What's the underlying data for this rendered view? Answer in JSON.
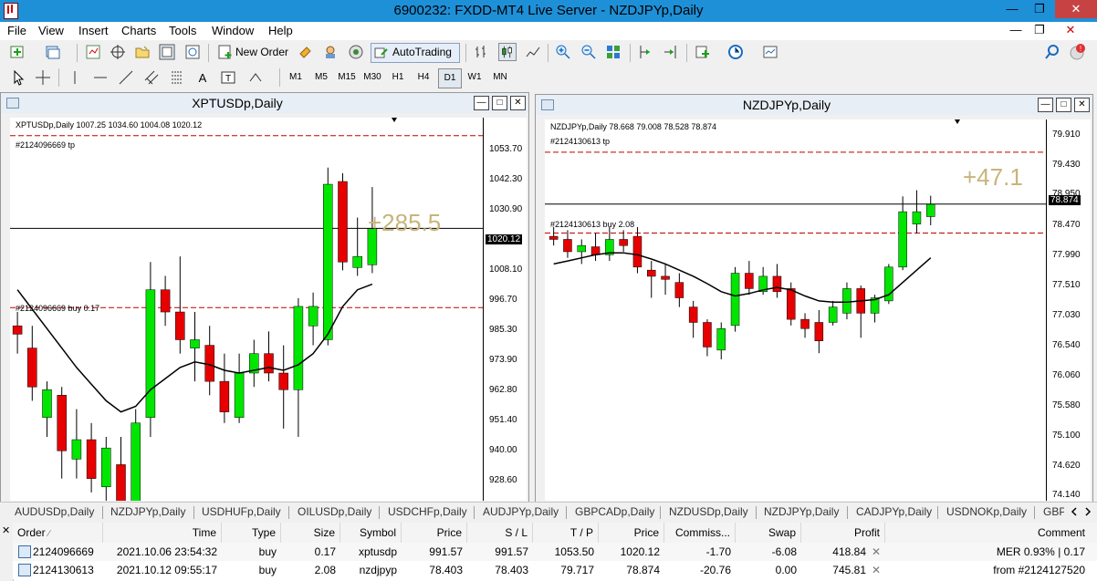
{
  "window": {
    "title": "6900232: FXDD-MT4 Live Server - NZDJPYp,Daily"
  },
  "menu": [
    "File",
    "View",
    "Insert",
    "Charts",
    "Tools",
    "Window",
    "Help"
  ],
  "toolbar": {
    "new_order": "New Order",
    "autotrading": "AutoTrading"
  },
  "timeframes": [
    "M1",
    "M5",
    "M15",
    "M30",
    "H1",
    "H4",
    "D1",
    "W1",
    "MN"
  ],
  "active_timeframe": "D1",
  "charts": [
    {
      "title": "XPTUSDp,Daily",
      "info": "XPTUSDp,Daily  1007.25 1034.60 1004.08 1020.12",
      "price_labels": [
        "1053.70",
        "1042.30",
        "1030.90",
        "1020.12",
        "1008.10",
        "996.70",
        "985.30",
        "973.90",
        "962.80",
        "951.40",
        "940.00",
        "928.60"
      ],
      "current_price": "1020.12",
      "tp_label": "#2124096669 tp",
      "order_label": "#2124096669 buy 0.17",
      "profit": "+285.5",
      "chart_data": {
        "type": "candlestick",
        "symbol": "XPTUSDp",
        "ylim": [
          922.0,
          1060.0
        ],
        "current": 1020.12,
        "tp_level": 1053.5,
        "order_level": 991.57,
        "candles": [
          {
            "o": 985,
            "h": 990,
            "l": 975,
            "c": 982
          },
          {
            "o": 977,
            "h": 985,
            "l": 958,
            "c": 963
          },
          {
            "o": 952,
            "h": 965,
            "l": 945,
            "c": 962
          },
          {
            "o": 960,
            "h": 963,
            "l": 930,
            "c": 940
          },
          {
            "o": 937,
            "h": 955,
            "l": 930,
            "c": 944
          },
          {
            "o": 944,
            "h": 950,
            "l": 925,
            "c": 930
          },
          {
            "o": 927,
            "h": 945,
            "l": 920,
            "c": 941
          },
          {
            "o": 935,
            "h": 945,
            "l": 900,
            "c": 904
          },
          {
            "o": 900,
            "h": 955,
            "l": 895,
            "c": 950
          },
          {
            "o": 952,
            "h": 1008,
            "l": 945,
            "c": 998
          },
          {
            "o": 998,
            "h": 1003,
            "l": 985,
            "c": 990
          },
          {
            "o": 990,
            "h": 1010,
            "l": 975,
            "c": 980
          },
          {
            "o": 977,
            "h": 990,
            "l": 965,
            "c": 980
          },
          {
            "o": 978,
            "h": 985,
            "l": 960,
            "c": 965
          },
          {
            "o": 965,
            "h": 975,
            "l": 950,
            "c": 954
          },
          {
            "o": 952,
            "h": 975,
            "l": 950,
            "c": 968
          },
          {
            "o": 968,
            "h": 980,
            "l": 963,
            "c": 975
          },
          {
            "o": 975,
            "h": 983,
            "l": 965,
            "c": 968
          },
          {
            "o": 968,
            "h": 978,
            "l": 948,
            "c": 962
          },
          {
            "o": 962,
            "h": 995,
            "l": 945,
            "c": 992
          },
          {
            "o": 985,
            "h": 997,
            "l": 978,
            "c": 992
          },
          {
            "o": 980,
            "h": 1042,
            "l": 978,
            "c": 1036
          },
          {
            "o": 1037,
            "h": 1040,
            "l": 1005,
            "c": 1008
          },
          {
            "o": 1006,
            "h": 1024,
            "l": 1003,
            "c": 1010
          },
          {
            "o": 1007,
            "h": 1035,
            "l": 1004,
            "c": 1020
          }
        ],
        "ma": [
          998,
          991,
          984,
          977,
          970,
          964,
          958,
          954,
          956,
          962,
          966,
          970,
          972,
          971,
          969,
          968,
          969,
          970,
          969,
          971,
          975,
          982,
          992,
          998,
          1000
        ]
      }
    },
    {
      "title": "NZDJPYp,Daily",
      "info": "NZDJPYp,Daily  78.668 79.008 78.528 78.874",
      "price_labels": [
        "79.910",
        "79.430",
        "78.950",
        "78.874",
        "78.470",
        "77.990",
        "77.510",
        "77.030",
        "76.540",
        "76.060",
        "75.580",
        "75.100",
        "74.620",
        "74.140"
      ],
      "current_price": "78.874",
      "tp_label": "#2124130613 tp",
      "order_label": "#2124130613 buy 2.08",
      "profit": "+47.1",
      "chart_data": {
        "type": "candlestick",
        "symbol": "NZDJPYp",
        "ylim": [
          74.05,
          80.25
        ],
        "current": 78.874,
        "tp_level": 79.717,
        "order_level": 78.403,
        "candles": [
          {
            "o": 78.35,
            "h": 78.5,
            "l": 78.2,
            "c": 78.3
          },
          {
            "o": 78.3,
            "h": 78.45,
            "l": 78.0,
            "c": 78.1
          },
          {
            "o": 78.1,
            "h": 78.3,
            "l": 77.9,
            "c": 78.2
          },
          {
            "o": 78.18,
            "h": 78.4,
            "l": 77.95,
            "c": 78.05
          },
          {
            "o": 78.05,
            "h": 78.5,
            "l": 77.95,
            "c": 78.3
          },
          {
            "o": 78.3,
            "h": 78.45,
            "l": 78.1,
            "c": 78.2
          },
          {
            "o": 78.35,
            "h": 78.5,
            "l": 77.75,
            "c": 77.85
          },
          {
            "o": 77.8,
            "h": 77.95,
            "l": 77.35,
            "c": 77.7
          },
          {
            "o": 77.7,
            "h": 77.9,
            "l": 77.4,
            "c": 77.65
          },
          {
            "o": 77.6,
            "h": 77.75,
            "l": 77.2,
            "c": 77.35
          },
          {
            "o": 77.2,
            "h": 77.3,
            "l": 76.7,
            "c": 76.95
          },
          {
            "o": 76.95,
            "h": 77.0,
            "l": 76.4,
            "c": 76.55
          },
          {
            "o": 76.5,
            "h": 76.95,
            "l": 76.35,
            "c": 76.85
          },
          {
            "o": 76.9,
            "h": 77.85,
            "l": 76.8,
            "c": 77.75
          },
          {
            "o": 77.75,
            "h": 77.95,
            "l": 77.4,
            "c": 77.5
          },
          {
            "o": 77.45,
            "h": 77.85,
            "l": 77.4,
            "c": 77.7
          },
          {
            "o": 77.7,
            "h": 77.9,
            "l": 77.35,
            "c": 77.45
          },
          {
            "o": 77.5,
            "h": 77.6,
            "l": 76.9,
            "c": 77.0
          },
          {
            "o": 77.0,
            "h": 77.1,
            "l": 76.7,
            "c": 76.85
          },
          {
            "o": 76.95,
            "h": 77.15,
            "l": 76.45,
            "c": 76.65
          },
          {
            "o": 76.95,
            "h": 77.3,
            "l": 76.9,
            "c": 77.2
          },
          {
            "o": 77.1,
            "h": 77.6,
            "l": 77.0,
            "c": 77.5
          },
          {
            "o": 77.5,
            "h": 77.55,
            "l": 76.7,
            "c": 77.1
          },
          {
            "o": 77.1,
            "h": 77.4,
            "l": 76.95,
            "c": 77.35
          },
          {
            "o": 77.3,
            "h": 77.9,
            "l": 77.25,
            "c": 77.85
          },
          {
            "o": 77.85,
            "h": 79.0,
            "l": 77.8,
            "c": 78.75
          },
          {
            "o": 78.55,
            "h": 79.1,
            "l": 78.4,
            "c": 78.75
          },
          {
            "o": 78.67,
            "h": 79.01,
            "l": 78.53,
            "c": 78.87
          }
        ],
        "ma": [
          77.9,
          77.95,
          78.0,
          78.05,
          78.08,
          78.08,
          78.05,
          77.98,
          77.9,
          77.8,
          77.7,
          77.58,
          77.45,
          77.38,
          77.42,
          77.48,
          77.52,
          77.48,
          77.38,
          77.3,
          77.28,
          77.28,
          77.3,
          77.32,
          77.4,
          77.6,
          77.8,
          78.0
        ]
      }
    }
  ],
  "tabs": [
    "AUDUSDp,Daily",
    "NZDJPYp,Daily",
    "USDHUFp,Daily",
    "OILUSDp,Daily",
    "USDCHFp,Daily",
    "AUDJPYp,Daily",
    "GBPCADp,Daily",
    "NZDUSDp,Daily",
    "NZDJPYp,Daily",
    "CADJPYp,Daily",
    "USDNOKp,Daily",
    "GBP"
  ],
  "trade_table": {
    "headers": [
      "Order",
      "Time",
      "Type",
      "Size",
      "Symbol",
      "Price",
      "S / L",
      "T / P",
      "Price",
      "Commiss...",
      "Swap",
      "Profit",
      "Comment"
    ],
    "rows": [
      [
        "2124096669",
        "2021.10.06 23:54:32",
        "buy",
        "0.17",
        "xptusdp",
        "991.57",
        "991.57",
        "1053.50",
        "1020.12",
        "-1.70",
        "-6.08",
        "418.84",
        "MER 0.93% | 0.17"
      ],
      [
        "2124130613",
        "2021.10.12 09:55:17",
        "buy",
        "2.08",
        "nzdjpyp",
        "78.403",
        "78.403",
        "79.717",
        "78.874",
        "-20.76",
        "0.00",
        "745.81",
        "from #2124127520"
      ]
    ]
  },
  "colors": {
    "bull": "#00e600",
    "bear": "#e60000",
    "title_bar": "#1e90d8",
    "order_line": "#c00000"
  }
}
